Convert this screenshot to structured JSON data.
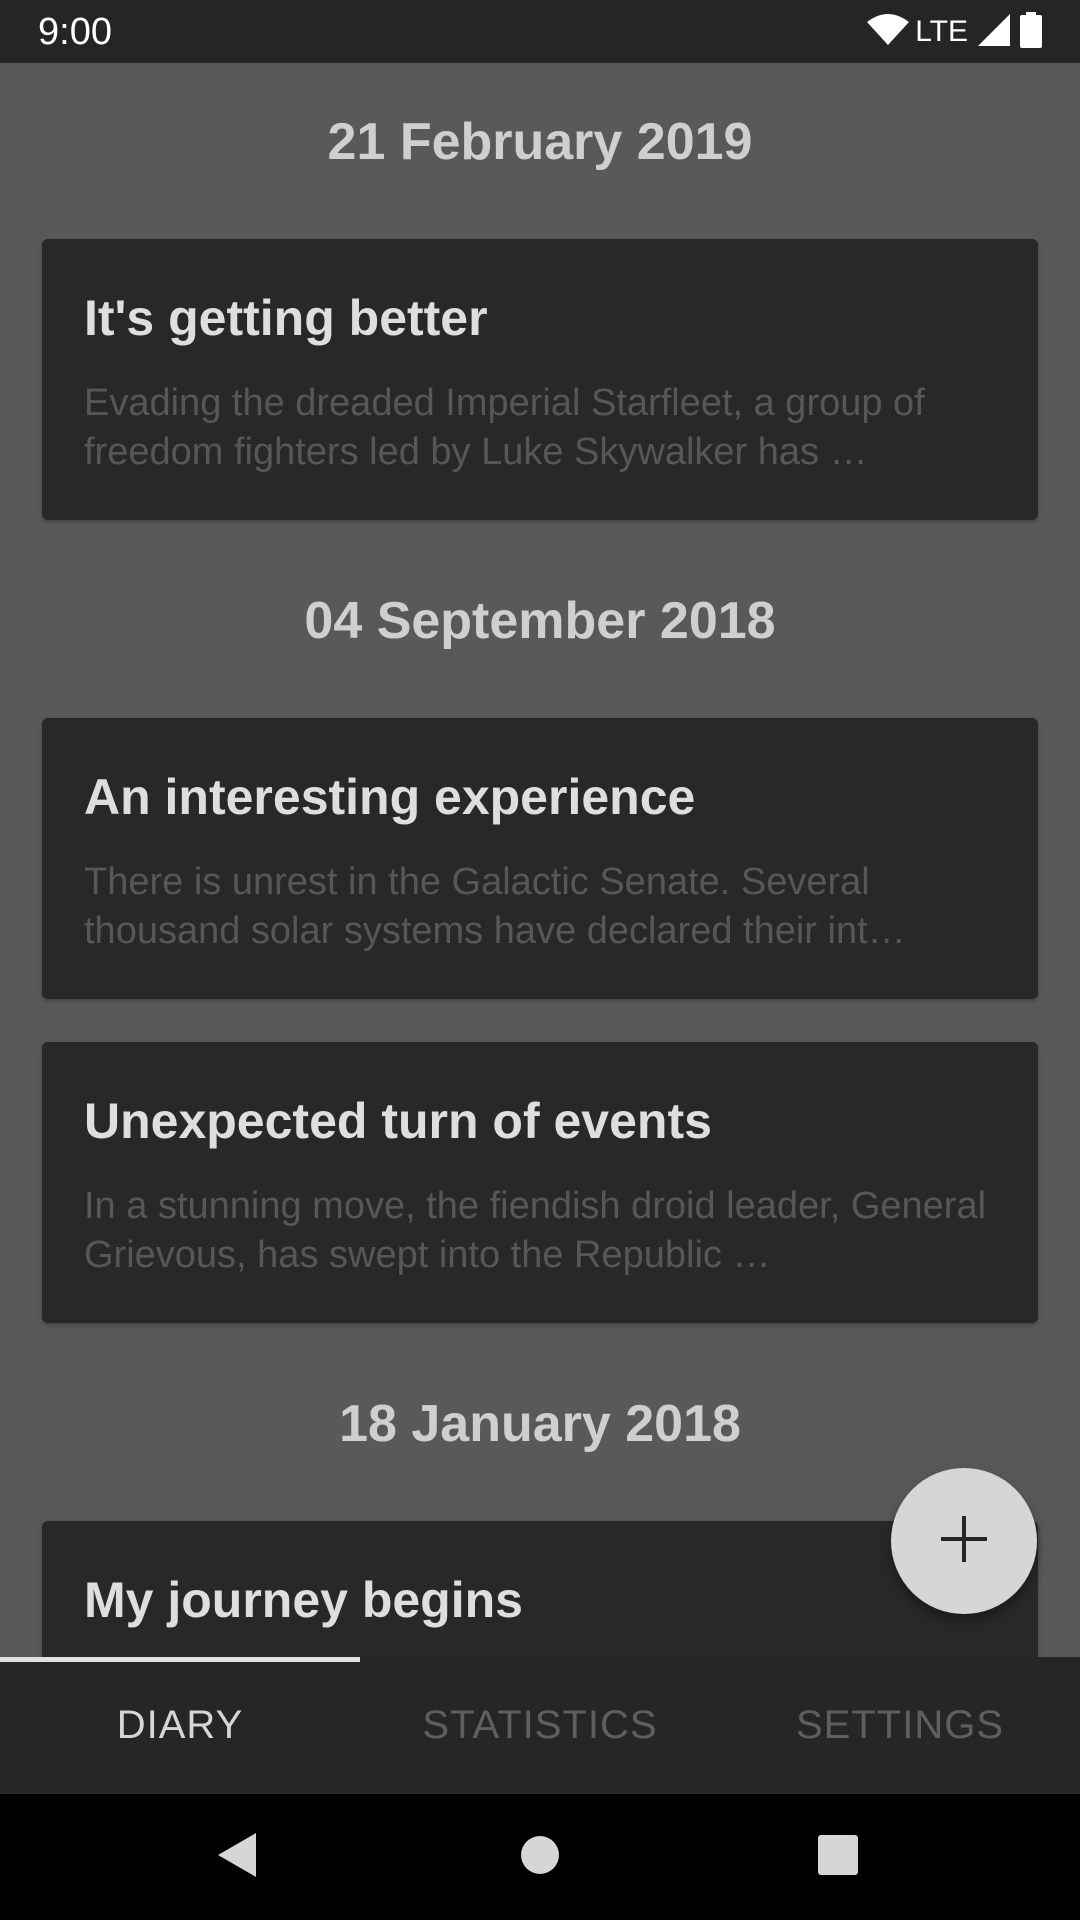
{
  "status_bar": {
    "time": "9:00",
    "network": "LTE"
  },
  "groups": [
    {
      "date": "21 February 2019",
      "entries": [
        {
          "title": "It's getting better",
          "excerpt": "Evading the dreaded Imperial Starfleet, a group of freedom fighters led by Luke Skywalker has …"
        }
      ]
    },
    {
      "date": "04 September 2018",
      "entries": [
        {
          "title": "An interesting experience",
          "excerpt": "There is unrest in the Galactic Senate. Several thousand solar systems have declared their int…"
        },
        {
          "title": "Unexpected turn of events",
          "excerpt": "In a stunning move, the fiendish droid leader, General Grievous, has swept into the Republic …"
        }
      ]
    },
    {
      "date": "18 January 2018",
      "entries": [
        {
          "title": "My journey begins",
          "excerpt": ""
        }
      ]
    }
  ],
  "fab": {
    "icon": "plus-icon"
  },
  "tabs": [
    {
      "label": "DIARY",
      "active": true
    },
    {
      "label": "STATISTICS",
      "active": false
    },
    {
      "label": "SETTINGS",
      "active": false
    }
  ],
  "nav": {
    "back_icon": "back-icon",
    "home_icon": "home-icon",
    "recents_icon": "recents-icon"
  },
  "colors": {
    "background": "#595959",
    "card": "#282828",
    "bar": "#262626",
    "accent": "#d6d6d6"
  }
}
